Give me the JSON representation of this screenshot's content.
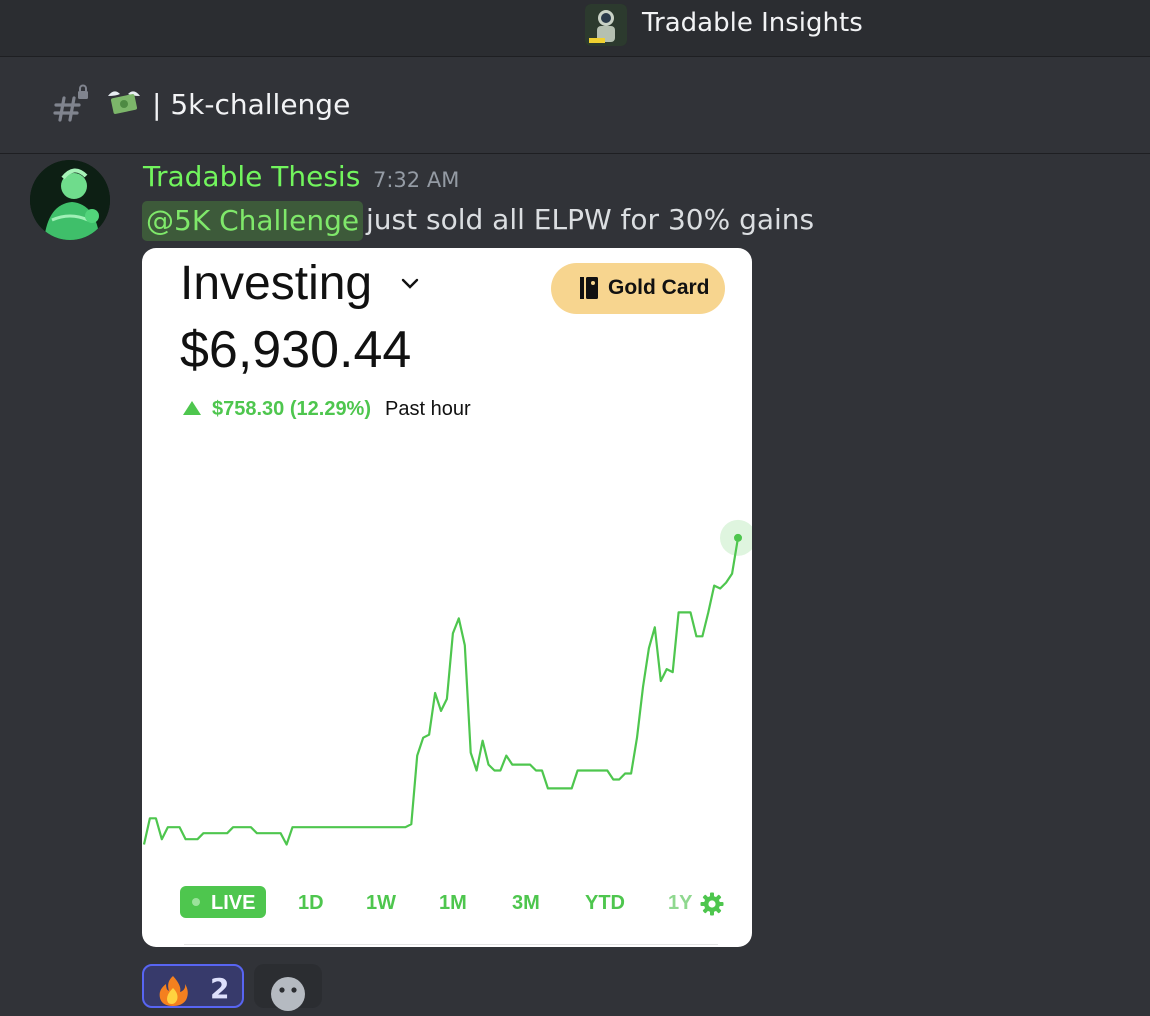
{
  "server": {
    "name": "Tradable Insights",
    "icon": "astronaut-server-icon"
  },
  "channel": {
    "emoji": "money-with-wings-icon",
    "separator": "|",
    "name": "5k-challenge"
  },
  "message": {
    "author": "Tradable Thesis",
    "author_color": "#72f55d",
    "timestamp": "7:32 AM",
    "mention": "@5K Challenge",
    "text": "just sold all ELPW for 30% gains"
  },
  "embed": {
    "title": "Investing",
    "gold_button": "Gold Card",
    "balance": "$6,930.44",
    "change_value": "$758.30 (12.29%)",
    "change_period": "Past hour",
    "accent_color": "#4ec64e",
    "ranges": {
      "live": "LIVE",
      "d1": "1D",
      "w1": "1W",
      "m1": "1M",
      "m3": "3M",
      "ytd": "YTD",
      "y1": "1Y"
    },
    "chart_data": {
      "type": "line",
      "title": "",
      "xlabel": "",
      "ylabel": "",
      "x": [
        0,
        1,
        2,
        3,
        4,
        5,
        6,
        7,
        8,
        9,
        10,
        11,
        12,
        13,
        14,
        15,
        16,
        17,
        18,
        19,
        20,
        21,
        22,
        23,
        24,
        25,
        26,
        27,
        28,
        29,
        30,
        31,
        32,
        33,
        34,
        35,
        36,
        37,
        38,
        39,
        40,
        41,
        42,
        43,
        44,
        45,
        46,
        47,
        48,
        49,
        50,
        51,
        52,
        53,
        54,
        55,
        56,
        57,
        58,
        59,
        60,
        61,
        62,
        63,
        64,
        65,
        66,
        67,
        68,
        69,
        70,
        71,
        72,
        73,
        74,
        75,
        76,
        77,
        78,
        79,
        80,
        81,
        82,
        83,
        84,
        85,
        86,
        87,
        88,
        89,
        90,
        91,
        92,
        93,
        94,
        95,
        96,
        97,
        98,
        99,
        100
      ],
      "y": [
        6172,
        6260,
        6260,
        6190,
        6230,
        6230,
        6230,
        6190,
        6190,
        6190,
        6210,
        6210,
        6210,
        6210,
        6210,
        6230,
        6230,
        6230,
        6230,
        6210,
        6210,
        6210,
        6210,
        6210,
        6172,
        6230,
        6230,
        6230,
        6230,
        6230,
        6230,
        6230,
        6230,
        6230,
        6230,
        6230,
        6230,
        6230,
        6230,
        6230,
        6230,
        6230,
        6230,
        6230,
        6230,
        6240,
        6470,
        6530,
        6540,
        6680,
        6620,
        6660,
        6880,
        6930,
        6840,
        6480,
        6420,
        6520,
        6440,
        6420,
        6420,
        6470,
        6440,
        6440,
        6440,
        6440,
        6420,
        6420,
        6360,
        6360,
        6360,
        6360,
        6360,
        6420,
        6420,
        6420,
        6420,
        6420,
        6420,
        6390,
        6390,
        6410,
        6410,
        6530,
        6700,
        6830,
        6900,
        6720,
        6760,
        6750,
        6950,
        6950,
        6950,
        6870,
        6870,
        6950,
        7040,
        7030,
        7050,
        7080,
        7200
      ],
      "ylim": [
        6100,
        7300
      ],
      "endpoint_marker": true,
      "grid": false,
      "legend": "none"
    }
  },
  "reactions": {
    "fire_emoji": "fire-icon",
    "fire_count": "2",
    "add_icon": "add-reaction-icon"
  }
}
